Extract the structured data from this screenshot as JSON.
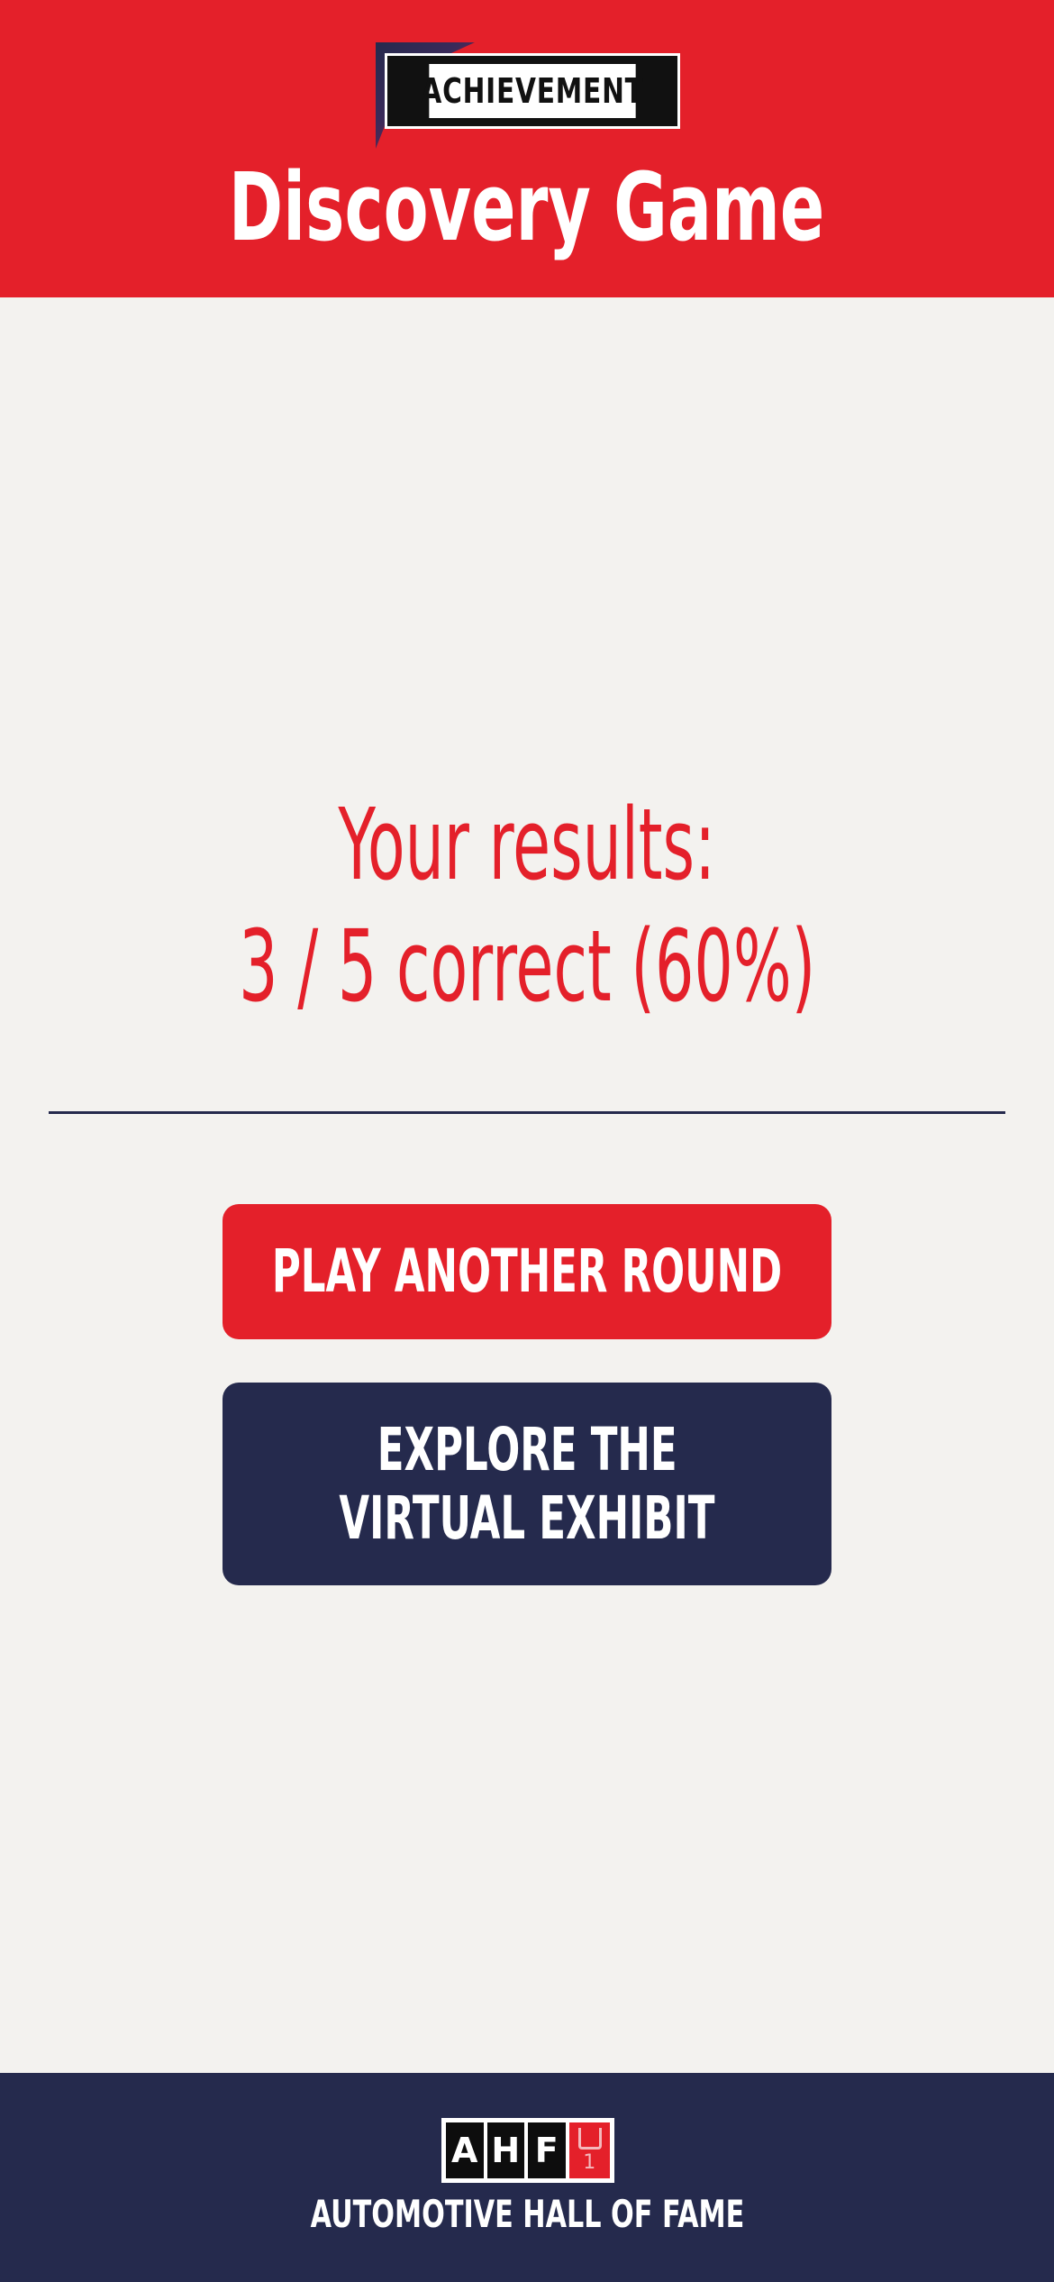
{
  "header": {
    "badge_label": "ACHIEVEMENT",
    "title": "Discovery Game",
    "background_color": "#e4202a"
  },
  "results": {
    "heading": "Your results:",
    "score_line": "3 / 5 correct (60%)",
    "correct": 3,
    "total": 5,
    "percent": 60,
    "color": "#e4202a"
  },
  "buttons": {
    "play_again_label": "PLAY ANOTHER ROUND",
    "explore_line1": "EXPLORE THE",
    "explore_line2": "VIRTUAL EXHIBIT",
    "play_color": "#e4202a",
    "explore_color": "#252a4d"
  },
  "footer": {
    "logo_letters": [
      "A",
      "H",
      "F"
    ],
    "logo_mark_number": "1",
    "organization": "AUTOMOTIVE HALL OF FAME",
    "background_color": "#252a4d"
  }
}
